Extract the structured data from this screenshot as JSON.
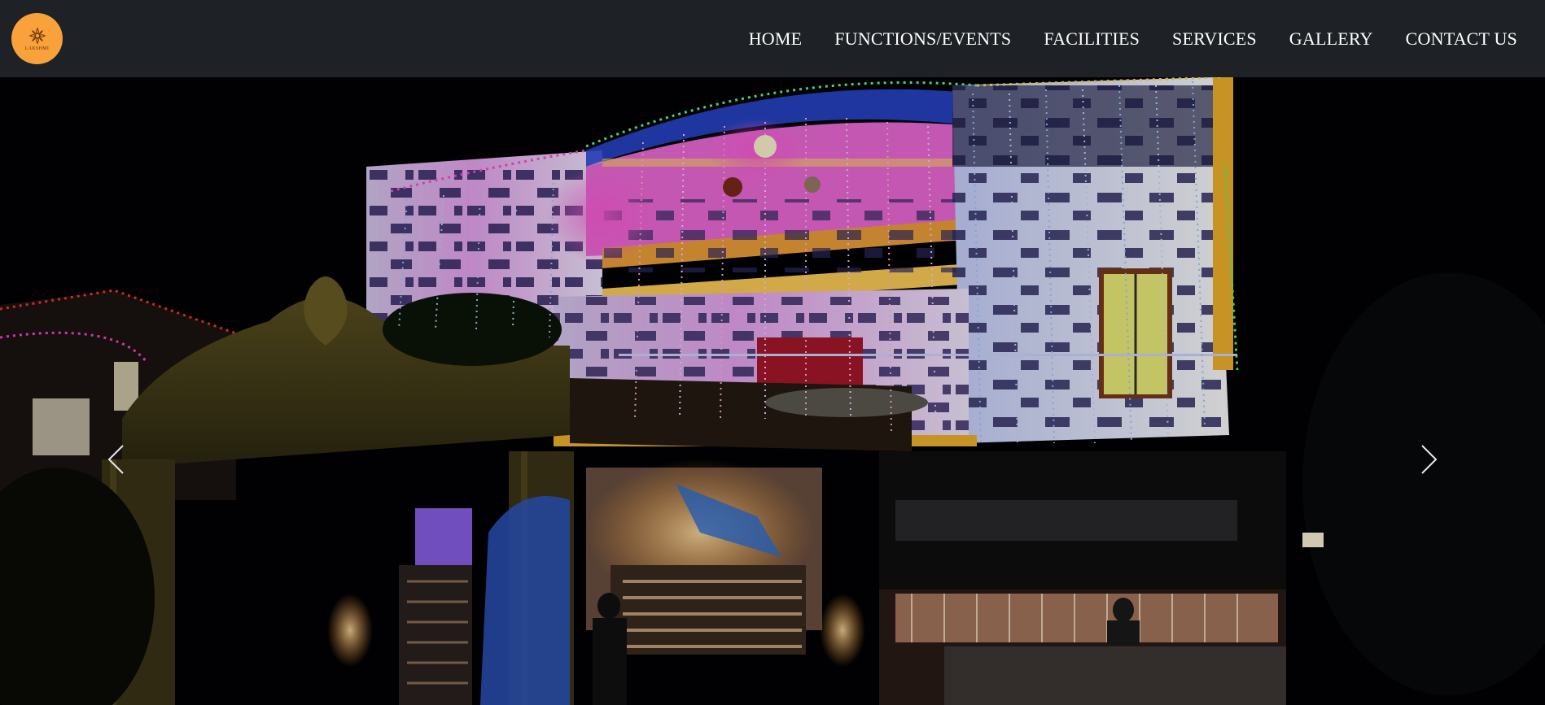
{
  "logo": {
    "text": "LAKSHMI",
    "icon": "lotus-logo-icon",
    "color": "#f9a13a"
  },
  "nav": {
    "items": [
      {
        "label": "HOME"
      },
      {
        "label": "FUNCTIONS/EVENTS"
      },
      {
        "label": "FACILITIES"
      },
      {
        "label": "SERVICES"
      },
      {
        "label": "GALLERY"
      },
      {
        "label": "CONTACT US"
      }
    ]
  },
  "slider": {
    "prev_icon": "chevron-left-icon",
    "next_icon": "chevron-right-icon"
  },
  "colors": {
    "navbar_bg": "#1e2126",
    "accent": "#f9a13a",
    "nav_text": "#ffffff"
  }
}
